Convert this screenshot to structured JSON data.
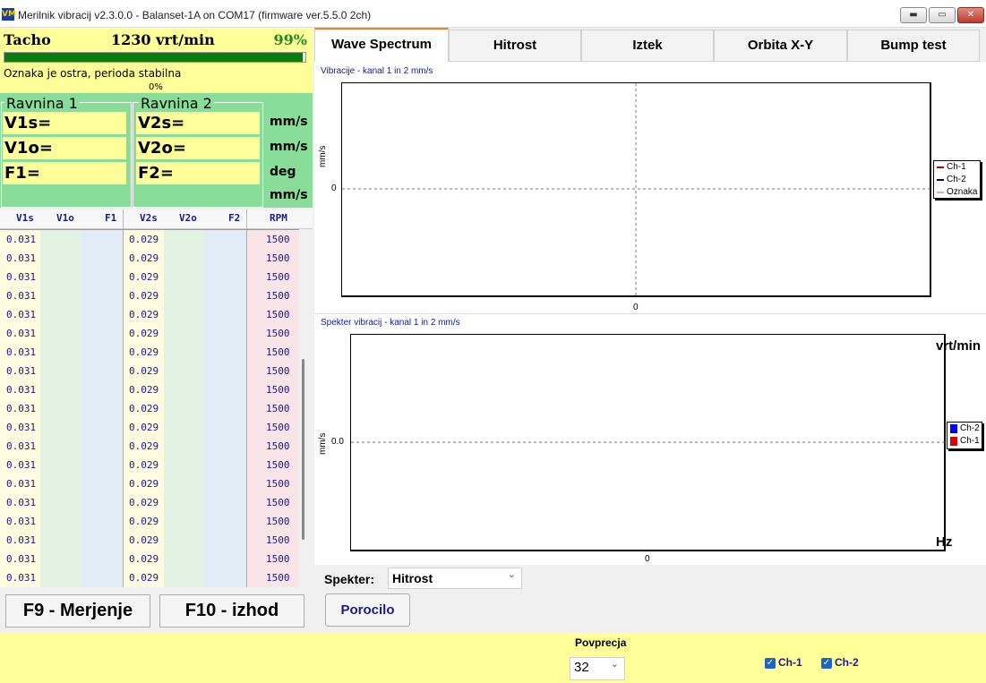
{
  "window": {
    "title": "Merilnik vibracij v2.3.0.0 - Balanset-1A on COM17 (firmware ver.5.5.0 2ch)",
    "icon": "vm-logo-icon",
    "buttons": {
      "minimize": "▬",
      "maximize": "▭",
      "close": "✕"
    }
  },
  "tacho": {
    "label": "Tacho",
    "rpm": "1230 vrt/min",
    "percent": "99%",
    "progress": 0.99,
    "status": "Oznaka je ostra, perioda stabilna",
    "zero": "0%"
  },
  "planes": {
    "plane1": {
      "title": "Ravnina 1",
      "v_s": "V1s=",
      "v_o": "V1o=",
      "f": "F1="
    },
    "plane2": {
      "title": "Ravnina 2",
      "v_s": "V2s=",
      "v_o": "V2o=",
      "f": "F2="
    },
    "units": [
      "mm/s",
      "mm/s",
      "deg",
      "mm/s"
    ]
  },
  "table": {
    "headers": [
      "V1s",
      "V1o",
      "F1",
      "V2s",
      "V2o",
      "F2",
      "RPM"
    ],
    "v1s": [
      "0.031",
      "0.031",
      "0.031",
      "0.031",
      "0.031",
      "0.031",
      "0.031",
      "0.031",
      "0.031",
      "0.031",
      "0.031",
      "0.031",
      "0.031",
      "0.031",
      "0.031",
      "0.031",
      "0.031",
      "0.031",
      "0.031"
    ],
    "v2s": [
      "0.029",
      "0.029",
      "0.029",
      "0.029",
      "0.029",
      "0.029",
      "0.029",
      "0.029",
      "0.029",
      "0.029",
      "0.029",
      "0.029",
      "0.029",
      "0.029",
      "0.029",
      "0.029",
      "0.029",
      "0.029",
      "0.029"
    ],
    "rpm": [
      "1500",
      "1500",
      "1500",
      "1500",
      "1500",
      "1500",
      "1500",
      "1500",
      "1500",
      "1500",
      "1500",
      "1500",
      "1500",
      "1500",
      "1500",
      "1500",
      "1500",
      "1500",
      "1500"
    ]
  },
  "buttons": {
    "measure": "F9 - Merjenje",
    "exit": "F10 - izhod",
    "report": "Porocilo"
  },
  "tabs": [
    "Wave Spectrum",
    "Hitrost",
    "Iztek",
    "Orbita X-Y",
    "Bump test"
  ],
  "wave_chart": {
    "title": "Vibracije  - kanal 1 in 2 mm/s",
    "ylabel": "mm/s",
    "y_zero": "0",
    "x_zero": "0",
    "legend": [
      {
        "name": "Ch-1",
        "color": "#c00000"
      },
      {
        "name": "Ch-2",
        "color": "#00008b"
      },
      {
        "name": "Oznaka",
        "color": "#e8a0c8"
      }
    ]
  },
  "spectrum_chart": {
    "title": "Spekter vibracij  - kanal 1 in 2 mm/s",
    "ylabel": "mm/s",
    "y_zero": "0.0",
    "x_zero": "0",
    "unit_top": "vrt/min",
    "unit_bottom": "Hz",
    "legend": [
      {
        "name": "Ch-2",
        "color": "#0000ff"
      },
      {
        "name": "Ch-1",
        "color": "#e00000"
      }
    ]
  },
  "spekter": {
    "label": "Spekter:",
    "value": "Hitrost"
  },
  "footer": {
    "povprecja_label": "Povprecja",
    "povprecja_value": "32",
    "ch1": "Ch-1",
    "ch2": "Ch-2",
    "check": "✓"
  }
}
